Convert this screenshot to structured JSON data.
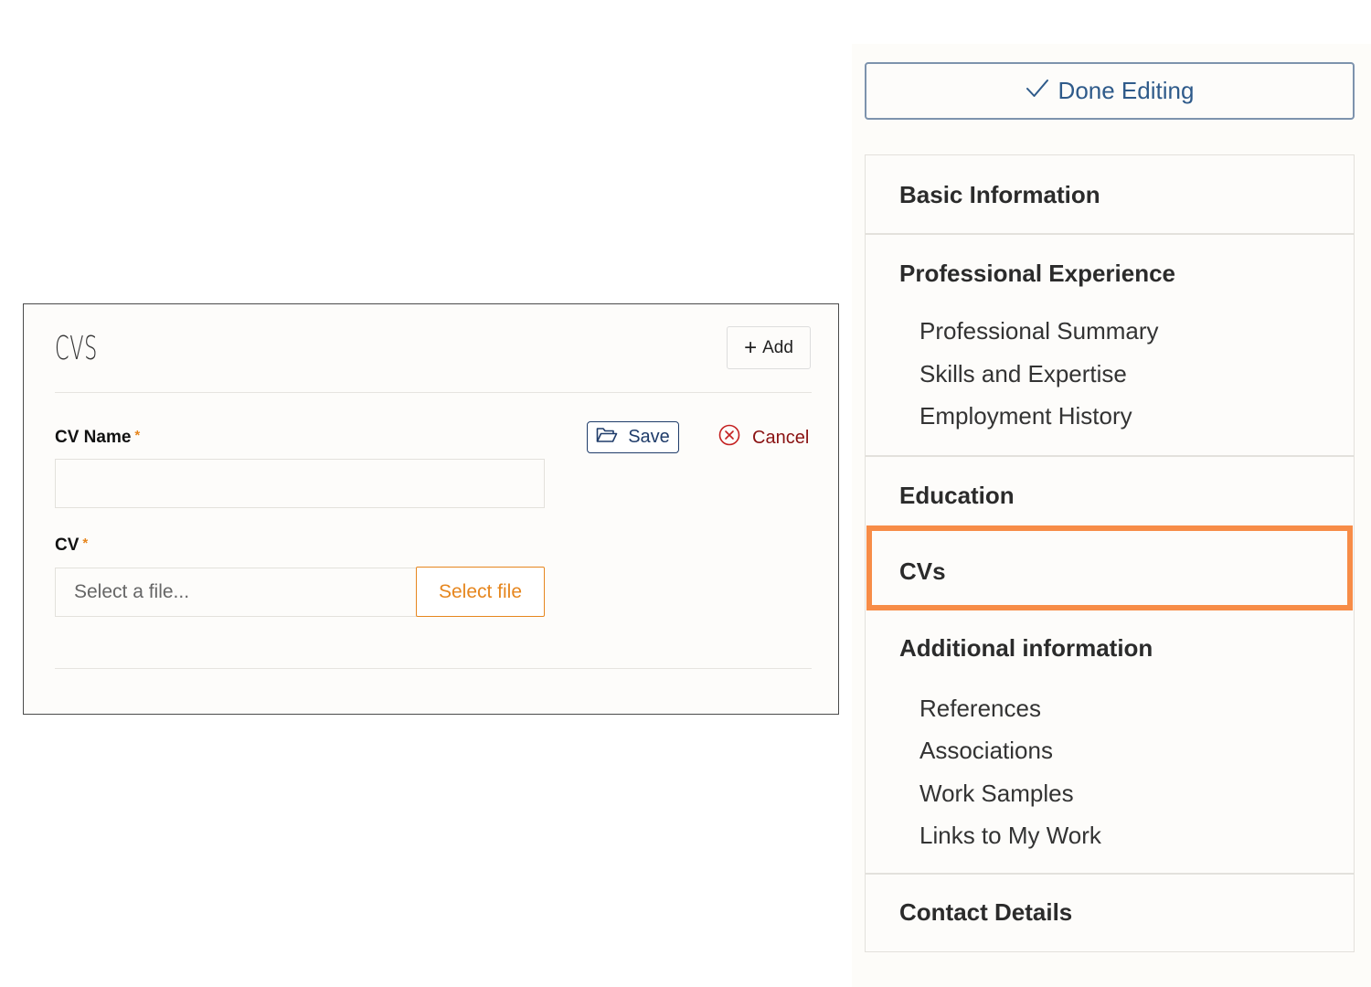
{
  "card": {
    "title": "CVS",
    "add_label": "Add",
    "cv_name_label": "CV Name",
    "cv_label": "CV",
    "required_mark": "*",
    "cv_name_value": "",
    "file_placeholder": "Select a file...",
    "select_file_label": "Select file",
    "save_label": "Save",
    "cancel_label": "Cancel"
  },
  "sidebar": {
    "done_label": "Done Editing",
    "sections": [
      {
        "label": "Basic Information"
      },
      {
        "label": "Professional Experience",
        "items": [
          "Professional Summary",
          "Skills and Expertise",
          "Employment History"
        ]
      },
      {
        "label": "Education"
      },
      {
        "label": "CVs",
        "active": true
      },
      {
        "label": "Additional information",
        "items": [
          "References",
          "Associations",
          "Work Samples",
          "Links to My Work"
        ]
      },
      {
        "label": "Contact Details"
      }
    ]
  },
  "colors": {
    "accent_orange": "#e6861e",
    "active_highlight": "#f78c47",
    "save_blue": "#1f3c6a",
    "done_blue": "#2e5a8a",
    "cancel_red": "#8a1212"
  },
  "icons": [
    "plus-icon",
    "folder-open-icon",
    "cancel-circle-icon",
    "checkmark-icon"
  ]
}
